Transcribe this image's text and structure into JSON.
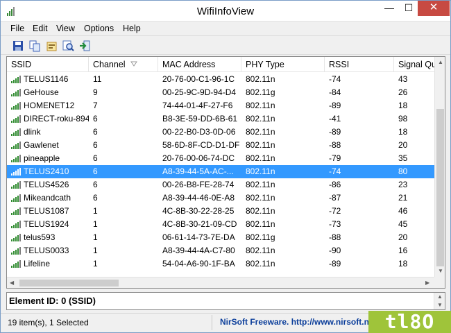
{
  "window": {
    "title": "WifiInfoView",
    "minimize_glyph": "—",
    "maximize_glyph": "☐",
    "close_glyph": "✕"
  },
  "menu": {
    "items": [
      {
        "label": "File"
      },
      {
        "label": "Edit"
      },
      {
        "label": "View"
      },
      {
        "label": "Options"
      },
      {
        "label": "Help"
      }
    ]
  },
  "toolbar": {
    "buttons": [
      {
        "icon": "save-icon"
      },
      {
        "icon": "copy-icon"
      },
      {
        "icon": "properties-icon"
      },
      {
        "icon": "find-icon"
      },
      {
        "icon": "exit-icon"
      }
    ]
  },
  "table": {
    "columns": [
      "SSID",
      "Channel",
      "MAC Address",
      "PHY Type",
      "RSSI",
      "Signal Qu"
    ],
    "sorted_column": "Channel",
    "rows": [
      {
        "ssid": "TELUS1146",
        "channel": "11",
        "mac": "20-76-00-C1-96-1C",
        "phy": "802.11n",
        "rssi": "-74",
        "signal": "43",
        "selected": false
      },
      {
        "ssid": "GeHouse",
        "channel": "9",
        "mac": "00-25-9C-9D-94-D4",
        "phy": "802.11g",
        "rssi": "-84",
        "signal": "26",
        "selected": false
      },
      {
        "ssid": "HOMENET12",
        "channel": "7",
        "mac": "74-44-01-4F-27-F6",
        "phy": "802.11n",
        "rssi": "-89",
        "signal": "18",
        "selected": false
      },
      {
        "ssid": "DIRECT-roku-894",
        "channel": "6",
        "mac": "B8-3E-59-DD-6B-61",
        "phy": "802.11n",
        "rssi": "-41",
        "signal": "98",
        "selected": false
      },
      {
        "ssid": "dlink",
        "channel": "6",
        "mac": "00-22-B0-D3-0D-06",
        "phy": "802.11n",
        "rssi": "-89",
        "signal": "18",
        "selected": false
      },
      {
        "ssid": "Gawlenet",
        "channel": "6",
        "mac": "58-6D-8F-CD-D1-DF",
        "phy": "802.11n",
        "rssi": "-88",
        "signal": "20",
        "selected": false
      },
      {
        "ssid": "pineapple",
        "channel": "6",
        "mac": "20-76-00-06-74-DC",
        "phy": "802.11n",
        "rssi": "-79",
        "signal": "35",
        "selected": false
      },
      {
        "ssid": "TELUS2410",
        "channel": "6",
        "mac": "A8-39-44-5A-AC-...",
        "phy": "802.11n",
        "rssi": "-74",
        "signal": "80",
        "selected": true
      },
      {
        "ssid": "TELUS4526",
        "channel": "6",
        "mac": "00-26-B8-FE-28-74",
        "phy": "802.11n",
        "rssi": "-86",
        "signal": "23",
        "selected": false
      },
      {
        "ssid": "Mikeandcath",
        "channel": "6",
        "mac": "A8-39-44-46-0E-A8",
        "phy": "802.11n",
        "rssi": "-87",
        "signal": "21",
        "selected": false
      },
      {
        "ssid": "TELUS1087",
        "channel": "1",
        "mac": "4C-8B-30-22-28-25",
        "phy": "802.11n",
        "rssi": "-72",
        "signal": "46",
        "selected": false
      },
      {
        "ssid": "TELUS1924",
        "channel": "1",
        "mac": "4C-8B-30-21-09-CD",
        "phy": "802.11n",
        "rssi": "-73",
        "signal": "45",
        "selected": false
      },
      {
        "ssid": "telus593",
        "channel": "1",
        "mac": "06-61-14-73-7E-DA",
        "phy": "802.11g",
        "rssi": "-88",
        "signal": "20",
        "selected": false
      },
      {
        "ssid": "TELUS0033",
        "channel": "1",
        "mac": "A8-39-44-4A-C7-80",
        "phy": "802.11n",
        "rssi": "-90",
        "signal": "16",
        "selected": false
      },
      {
        "ssid": "Lifeline",
        "channel": "1",
        "mac": "54-04-A6-90-1F-BA",
        "phy": "802.11n",
        "rssi": "-89",
        "signal": "18",
        "selected": false
      }
    ]
  },
  "element_pane": {
    "text": "Element ID: 0  (SSID)"
  },
  "status": {
    "count_text": "19 item(s), 1 Selected",
    "link_text": "NirSoft Freeware.  http://www.nirsoft.net"
  },
  "watermark": {
    "text": "tl8O"
  },
  "colors": {
    "selection": "#3399ff",
    "close_button": "#c74a42",
    "link": "#0a3d9a",
    "watermark": "#9fc43a"
  }
}
